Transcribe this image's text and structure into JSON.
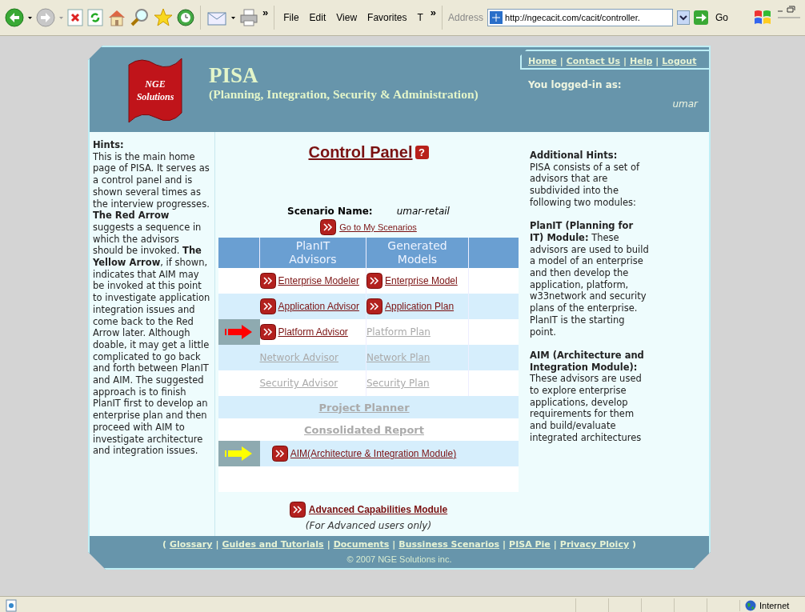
{
  "browser": {
    "more": "»",
    "menu": [
      "File",
      "Edit",
      "View",
      "Favorites",
      "T"
    ],
    "menu_more": "»",
    "address_label": "Address",
    "url": "http://ngecacit.com/cacit/controller.",
    "go": "Go"
  },
  "header": {
    "logo_lines": [
      "NGE",
      "Solutions"
    ],
    "title": "PISA",
    "subtitle": "(Planning, Integration, Security & Administration)",
    "separator": "|",
    "links": [
      "Home",
      "Contact Us",
      "Help",
      "Logout"
    ],
    "login_label": "You logged-in as:",
    "user": "umar"
  },
  "hints": {
    "title": "Hints:",
    "text": "This is the main home page of PISA. It serves as a control panel and is shown several times as the interview progresses. **The Red Arrow** suggests a sequence in which the advisors should be invoked. **The Yellow Arrow**, if shown, indicates that AIM may be invoked at this point to investigate application integration issues and come back to the Red Arrow later. Although doable, it may get a little complicated to go back and forth between PlanIT and AIM. The suggested approach is to finish PlanIT first to develop an enterprise plan and then proceed with AIM to investigate architecture and integration issues."
  },
  "panel": {
    "title": "Control Panel",
    "help": "?",
    "scenario_label": "Scenario Name:",
    "scenario": "umar-retail",
    "scenarios_link": "Go to My Scenarios",
    "columns": [
      "PlanIT\nAdvisors",
      "Generated\nModels"
    ],
    "rows": [
      {
        "kind": "pair",
        "cells": [
          {
            "label": "Enterprise Modeler",
            "enabled": true
          },
          {
            "label": "Enterprise Model",
            "enabled": true
          }
        ]
      },
      {
        "kind": "pair",
        "cells": [
          {
            "label": "Application Advisor",
            "enabled": true
          },
          {
            "label": "Application Plan",
            "enabled": true
          }
        ]
      },
      {
        "kind": "pair",
        "arrow": {
          "color": "#ff0000"
        },
        "cells": [
          {
            "label": "Platform Advisor",
            "enabled": true
          },
          {
            "label": "Platform Plan",
            "enabled": false
          }
        ]
      },
      {
        "kind": "pair",
        "cells": [
          {
            "label": "Network Advisor",
            "enabled": false
          },
          {
            "label": "Network Plan",
            "enabled": false
          }
        ]
      },
      {
        "kind": "pair",
        "cells": [
          {
            "label": "Security Advisor",
            "enabled": false
          },
          {
            "label": "Security Plan",
            "enabled": false
          }
        ]
      },
      {
        "kind": "wide",
        "bold": true,
        "cells": [
          {
            "label": "Project Planner",
            "enabled": false
          }
        ]
      },
      {
        "kind": "wide",
        "bold": true,
        "cells": [
          {
            "label": "Consolidated Report",
            "enabled": false
          }
        ]
      },
      {
        "kind": "wide",
        "bold": false,
        "arrow": {
          "color": "#ffff00"
        },
        "cells": [
          {
            "label": "AIM(Architecture & Integration Module)",
            "enabled": true
          }
        ]
      },
      {
        "kind": "blank"
      }
    ],
    "advanced_link": "Advanced Capabilities Module",
    "advanced_note": "(For Advanced users only)"
  },
  "additional": {
    "title": "Additional Hints:",
    "paragraphs": [
      "PISA consists of a set of advisors that are subdivided into the following two modules:",
      "**PlanIT (Planning for IT) Module:** These advisors are used to build a model of an enterprise and then develop the application, platform, w33network and security plans of the enterprise. PlanIT is the starting point.",
      "**AIM (Architecture and Integration Module):** These advisors are used to explore enterprise applications, develop requirements for them and build/evaluate integrated architectures"
    ]
  },
  "footer": {
    "open": "(",
    "close": ")",
    "separator": "|",
    "links": [
      "Glossary",
      "Guides and Tutorials",
      "Documents",
      "Bussiness Scenarios",
      "PISA Pie",
      "Privacy Ploicy"
    ],
    "copyright": "© 2007 NGE Solutions inc."
  },
  "status_bar": {
    "zone": "Internet"
  }
}
